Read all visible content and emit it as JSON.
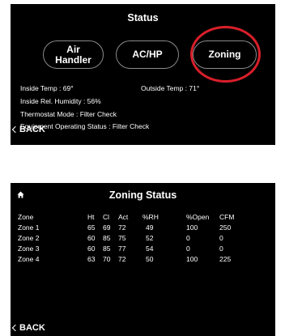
{
  "status_screen": {
    "title": "Status",
    "buttons": {
      "air_handler": [
        "Air",
        "Handler"
      ],
      "ac_hp": "AC/HP",
      "zoning": "Zoning"
    },
    "info": {
      "inside_temp": "Inside Temp :  69°",
      "outside_temp": "Outside Temp :  71°",
      "inside_humidity": "Inside Rel. Humidity :  56%",
      "thermostat_mode": "Thermostat Mode :  Filter Check",
      "equipment_status": "Equipment Operating Status :  Filter Check"
    },
    "back_label": "BACK"
  },
  "zoning_screen": {
    "title": "Zoning Status",
    "columns": [
      "Zone",
      "Ht",
      "Cl",
      "Act",
      "%RH",
      "%Open",
      "CFM"
    ],
    "rows": [
      [
        "Zone 1",
        "65",
        "69",
        "72",
        "49",
        "100",
        "250"
      ],
      [
        "Zone 2",
        "60",
        "85",
        "75",
        "52",
        "0",
        "0"
      ],
      [
        "Zone 3",
        "60",
        "85",
        "77",
        "54",
        "0",
        "0"
      ],
      [
        "Zone 4",
        "63",
        "70",
        "72",
        "50",
        "100",
        "225"
      ]
    ],
    "back_label": "BACK"
  },
  "colors": {
    "background": "#000000",
    "text": "#ffffff",
    "highlight_ring": "#d81f2a",
    "button_border": "#8a8a8a"
  },
  "icons": {
    "home": "home-icon",
    "back": "chevron-left-icon"
  }
}
